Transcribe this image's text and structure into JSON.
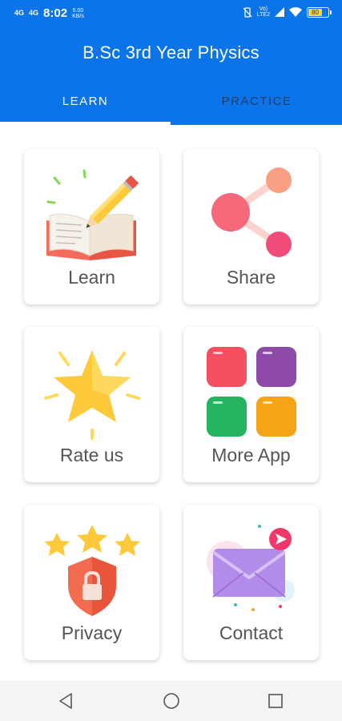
{
  "status_bar": {
    "signal_1": "4G",
    "signal_2": "4G",
    "time": "8:02",
    "net_speed_value": "6.00",
    "net_speed_unit": "KB/s",
    "volte": "Vo)",
    "lte": "LTE2",
    "battery": "80"
  },
  "header": {
    "title": "B.Sc 3rd Year Physics"
  },
  "tabs": [
    {
      "label": "LEARN",
      "selected": true
    },
    {
      "label": "PRACTICE",
      "selected": false
    }
  ],
  "cards": [
    {
      "label": "Learn",
      "icon": "pencil-book-icon"
    },
    {
      "label": "Share",
      "icon": "share-icon"
    },
    {
      "label": "Rate us",
      "icon": "star-icon"
    },
    {
      "label": "More App",
      "icon": "apps-grid-icon"
    },
    {
      "label": "Privacy",
      "icon": "shield-lock-icon"
    },
    {
      "label": "Contact",
      "icon": "envelope-icon"
    }
  ],
  "colors": {
    "app_bar": "#0a74e8",
    "tab_inactive": "#1b3f70",
    "card_label": "#555555"
  },
  "nav": [
    "back-icon",
    "home-icon",
    "recents-icon"
  ]
}
